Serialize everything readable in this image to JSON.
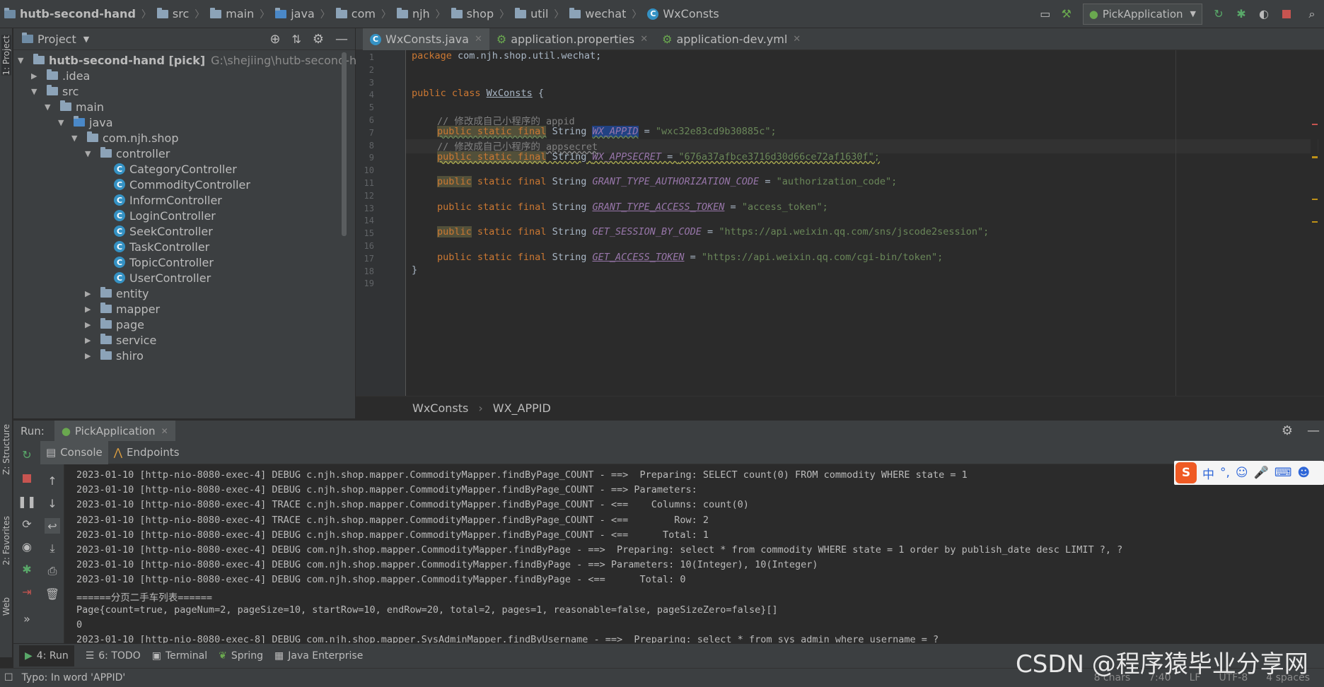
{
  "navbar": {
    "breadcrumbs": [
      "hutb-second-hand",
      "src",
      "main",
      "java",
      "com",
      "njh",
      "shop",
      "util",
      "wechat",
      "WxConsts"
    ],
    "run_config": "PickApplication"
  },
  "left_stripe": {
    "project": "1: Project",
    "structure": "Z: Structure",
    "favorites": "2: Favorites",
    "web": "Web"
  },
  "project_panel": {
    "title": "Project",
    "tree": [
      {
        "label": "hutb-second-hand [pick]",
        "extra": "G:\\shejiing\\hutb-second-hand",
        "depth": 0,
        "kind": "module",
        "expanded": true
      },
      {
        "label": ".idea",
        "depth": 1,
        "kind": "folder",
        "expanded": false
      },
      {
        "label": "src",
        "depth": 1,
        "kind": "folder",
        "expanded": true
      },
      {
        "label": "main",
        "depth": 2,
        "kind": "folder",
        "expanded": true
      },
      {
        "label": "java",
        "depth": 3,
        "kind": "folder",
        "expanded": true
      },
      {
        "label": "com.njh.shop",
        "depth": 4,
        "kind": "package",
        "expanded": true
      },
      {
        "label": "controller",
        "depth": 5,
        "kind": "package",
        "expanded": true
      },
      {
        "label": "CategoryController",
        "depth": 6,
        "kind": "class"
      },
      {
        "label": "CommodityController",
        "depth": 6,
        "kind": "class"
      },
      {
        "label": "InformController",
        "depth": 6,
        "kind": "class"
      },
      {
        "label": "LoginController",
        "depth": 6,
        "kind": "class"
      },
      {
        "label": "SeekController",
        "depth": 6,
        "kind": "class"
      },
      {
        "label": "TaskController",
        "depth": 6,
        "kind": "class"
      },
      {
        "label": "TopicController",
        "depth": 6,
        "kind": "class"
      },
      {
        "label": "UserController",
        "depth": 6,
        "kind": "class"
      },
      {
        "label": "entity",
        "depth": 5,
        "kind": "package",
        "expanded": false
      },
      {
        "label": "mapper",
        "depth": 5,
        "kind": "package",
        "expanded": false
      },
      {
        "label": "page",
        "depth": 5,
        "kind": "package",
        "expanded": false
      },
      {
        "label": "service",
        "depth": 5,
        "kind": "package",
        "expanded": false
      },
      {
        "label": "shiro",
        "depth": 5,
        "kind": "package",
        "expanded": false
      }
    ]
  },
  "editor": {
    "tabs": [
      {
        "label": "WxConsts.java",
        "active": true
      },
      {
        "label": "application.properties",
        "active": false
      },
      {
        "label": "application-dev.yml",
        "active": false
      }
    ],
    "line_numbers": [
      "1",
      "2",
      "3",
      "4",
      "5",
      "6",
      "7",
      "8",
      "9",
      "10",
      "11",
      "12",
      "13",
      "14",
      "15",
      "16",
      "17",
      "18",
      "19"
    ],
    "code": {
      "package_kw": "package",
      "package_name": " com.njh.shop.util.wechat;",
      "class_kw": "public class ",
      "class_name": "WxConsts",
      "class_open": " {",
      "comment1": "// 修改成自己小程序的 appid",
      "mod": "public static final",
      "type": " String ",
      "appid_name": "WX_APPID",
      "appid_value": "\"wxc32e83cd9b30885c\";",
      "comment2": "// 修改成自己小程序的 appsecret",
      "secret_name": "WX_APPSECRET",
      "secret_value": "\"676a37afbce3716d30d66ce72af1630f\";",
      "public_kw": "public",
      "static_final": " static final",
      "c3_name": "GRANT_TYPE_AUTHORIZATION_CODE",
      "c3_value": "\"authorization_code\";",
      "c4_name": "GRANT_TYPE_ACCESS_TOKEN",
      "c4_value": "\"access_token\";",
      "c5_name": "GET_SESSION_BY_CODE",
      "c5_value": "\"https://api.weixin.qq.com/sns/jscode2session\";",
      "c6_name": "GET_ACCESS_TOKEN",
      "c6_value": "\"https://api.weixin.qq.com/cgi-bin/token\";",
      "eq": " = ",
      "close": "}"
    },
    "breadcrumb": [
      "WxConsts",
      "WX_APPID"
    ]
  },
  "run_panel": {
    "label": "Run:",
    "config_tab": "PickApplication",
    "subtabs": [
      "Console",
      "Endpoints"
    ],
    "console_lines": [
      "2023-01-10 [http-nio-8080-exec-4] DEBUG c.njh.shop.mapper.CommodityMapper.findByPage_COUNT - ==>  Preparing: SELECT count(0) FROM commodity WHERE state = 1",
      "2023-01-10 [http-nio-8080-exec-4] DEBUG c.njh.shop.mapper.CommodityMapper.findByPage_COUNT - ==> Parameters: ",
      "2023-01-10 [http-nio-8080-exec-4] TRACE c.njh.shop.mapper.CommodityMapper.findByPage_COUNT - <==    Columns: count(0)",
      "2023-01-10 [http-nio-8080-exec-4] TRACE c.njh.shop.mapper.CommodityMapper.findByPage_COUNT - <==        Row: 2",
      "2023-01-10 [http-nio-8080-exec-4] DEBUG c.njh.shop.mapper.CommodityMapper.findByPage_COUNT - <==      Total: 1",
      "2023-01-10 [http-nio-8080-exec-4] DEBUG com.njh.shop.mapper.CommodityMapper.findByPage - ==>  Preparing: select * from commodity WHERE state = 1 order by publish_date desc LIMIT ?, ?",
      "2023-01-10 [http-nio-8080-exec-4] DEBUG com.njh.shop.mapper.CommodityMapper.findByPage - ==> Parameters: 10(Integer), 10(Integer)",
      "2023-01-10 [http-nio-8080-exec-4] DEBUG com.njh.shop.mapper.CommodityMapper.findByPage - <==      Total: 0",
      "======分页二手车列表======",
      "Page{count=true, pageNum=2, pageSize=10, startRow=10, endRow=20, total=2, pages=1, reasonable=false, pageSizeZero=false}[]",
      "0",
      "2023-01-10 [http-nio-8080-exec-8] DEBUG com.njh.shop.mapper.SysAdminMapper.findByUsername - ==>  Preparing: select * from sys_admin where username = ?"
    ]
  },
  "bottom_tabs": [
    "4: Run",
    "6: TODO",
    "Terminal",
    "Spring",
    "Java Enterprise"
  ],
  "status": {
    "message": "Typo: In word 'APPID'",
    "chars": "8 chars",
    "position": "7:40",
    "line_sep": "LF",
    "encoding": "UTF-8",
    "indent": "4 spaces"
  },
  "ime_toolbar": {
    "lang": "中",
    "punct": "°,"
  },
  "watermark": "CSDN @程序猿毕业分享网",
  "colors": {
    "keyword": "#cc7832",
    "string": "#6a8759",
    "comment": "#808080",
    "constant": "#9876aa",
    "accent": "#4a88c7"
  }
}
